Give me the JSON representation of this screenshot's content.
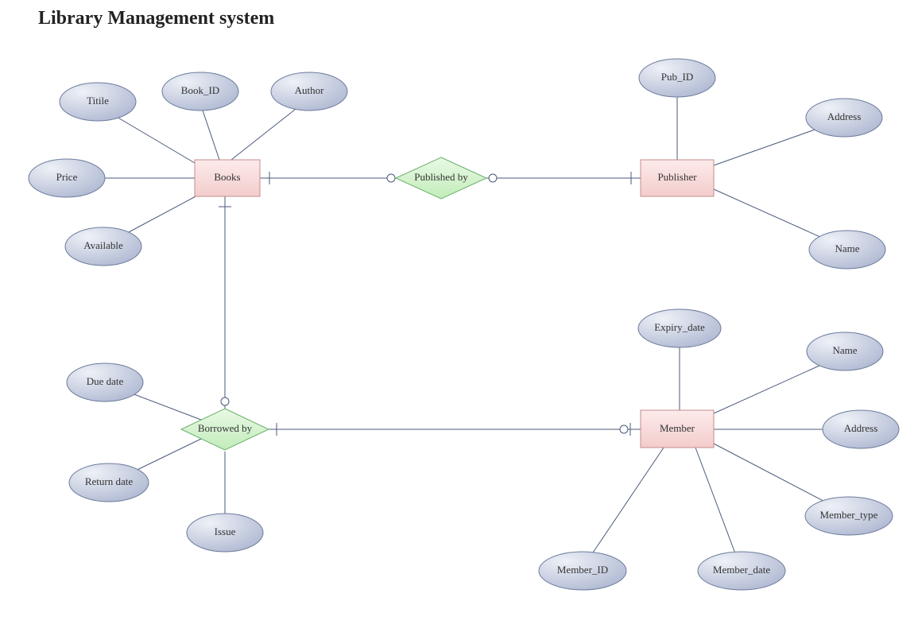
{
  "title": "Library Management system",
  "entities": {
    "books": {
      "label": "Books"
    },
    "publisher": {
      "label": "Publisher"
    },
    "member": {
      "label": "Member"
    }
  },
  "relationships": {
    "published_by": {
      "label": "Published by"
    },
    "borrowed_by": {
      "label": "Borrowed by"
    }
  },
  "attributes": {
    "books": {
      "book_id": "Book_ID",
      "author": "Author",
      "titile": "Titile",
      "price": "Price",
      "available": "Available"
    },
    "publisher": {
      "pub_id": "Pub_ID",
      "address": "Address",
      "name": "Name"
    },
    "member": {
      "expiry_date": "Expiry_date",
      "name": "Name",
      "address": "Address",
      "member_type": "Member_type",
      "member_date": "Member_date",
      "member_id": "Member_ID"
    },
    "borrowed_by": {
      "due_date": "Due date",
      "return_date": "Return date",
      "issue": "Issue"
    }
  }
}
